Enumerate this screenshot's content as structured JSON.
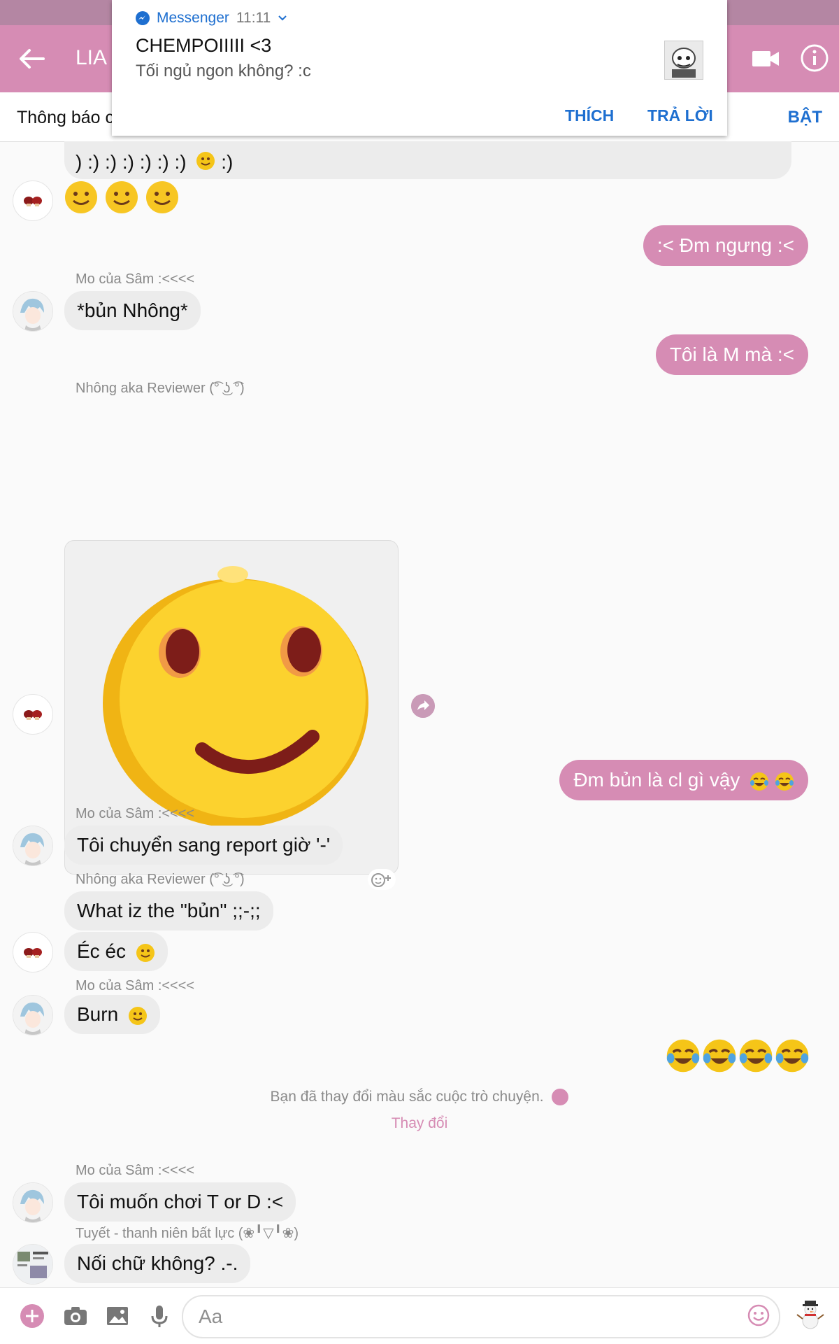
{
  "colors": {
    "accent": "#d68cb4",
    "blue": "#1e6fd0",
    "bubble_in": "#ececec"
  },
  "header": {
    "title": "LIA i"
  },
  "notice_bar": {
    "text": "Thông báo cl",
    "action": "BẬT"
  },
  "heads_up": {
    "app": "Messenger",
    "time": "11:11",
    "sender": "CHEMPOIIIII <3",
    "message": "Tối ngủ ngon không? :c",
    "action_like": "THÍCH",
    "action_reply": "TRẢ LỜI"
  },
  "messages": {
    "m1_text": ") :) :) :) :) :) :)",
    "m1_tail": ":)",
    "m3_text": ":< Đm ngưng :<",
    "m4_sender": "Mo của Sâm :<<<<",
    "m4_text": "*bủn Nhông*",
    "m5_text": "Tôi là M mà :<",
    "m6_sender": "Nhông aka Reviewer (͡° ͜ʖ ͡°)",
    "m7_text": "Đm bủn là cl gì vậy",
    "m8_sender": "Mo của Sâm :<<<<",
    "m8_text": "Tôi chuyển sang report giờ '-'",
    "m9_sender": "Nhông aka Reviewer (͡° ͜ʖ ͡°)",
    "m9_text": "What iz the \"bủn\" ;;-;;",
    "m10_text": "Éc éc",
    "m11_sender": "Mo của Sâm :<<<<",
    "m11_text": "Burn",
    "system_text": "Bạn đã thay đổi màu sắc cuộc trò chuyện.",
    "system_link": "Thay đổi",
    "m13_sender": "Mo của Sâm :<<<<",
    "m13_text": "Tôi muốn chơi T or D :<",
    "m14_sender": "Tuyết - thanh niên bất lực (❀╹▽╹❀)",
    "m14_text": "Nối chữ không? .-."
  },
  "composer": {
    "placeholder": "Aa"
  }
}
